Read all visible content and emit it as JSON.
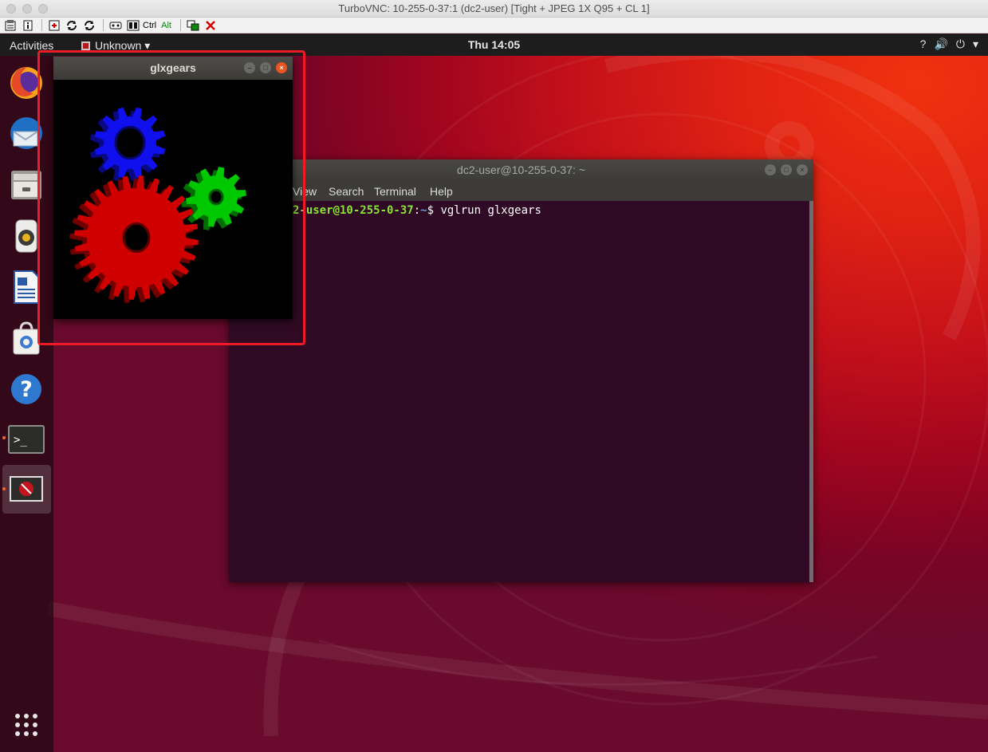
{
  "vnc_window": {
    "title": "TurboVNC: 10-255-0-37:1 (dc2-user) [Tight + JPEG 1X Q95 + CL 1]"
  },
  "vnc_toolbar": {
    "ctrl_label": "Ctrl",
    "alt_label": "Alt"
  },
  "topbar": {
    "activities": "Activities",
    "app_menu": "Unknown ▾",
    "clock": "Thu 14:05",
    "tray": {
      "accessibility": "?",
      "volume": "🔊",
      "power": "⏻",
      "arrow": "▾"
    }
  },
  "dock": {
    "items": [
      "firefox-icon",
      "thunderbird-icon",
      "files-icon",
      "rhythmbox-icon",
      "libreoffice-writer-icon",
      "software-icon",
      "help-icon",
      "terminal-icon",
      "glxgears-app-icon"
    ],
    "help_glyph": "?",
    "terminal_glyph": ">_"
  },
  "terminal": {
    "title": "dc2-user@10-255-0-37: ~",
    "menu": [
      "View",
      "Search",
      "Terminal",
      "Help"
    ],
    "prompt_user": "2-user@10-255-0-37",
    "prompt_sep": ":",
    "prompt_path": "~",
    "prompt_symbol": "$ ",
    "command": "vglrun glxgears"
  },
  "glxgears": {
    "title": "glxgears",
    "gear_colors": {
      "red": "#d00000",
      "green": "#00c800",
      "blue": "#1010ee"
    }
  },
  "colors": {
    "ubuntu_orange": "#e95420",
    "terminal_bg": "#300a24",
    "highlight": "#ee1b24"
  }
}
